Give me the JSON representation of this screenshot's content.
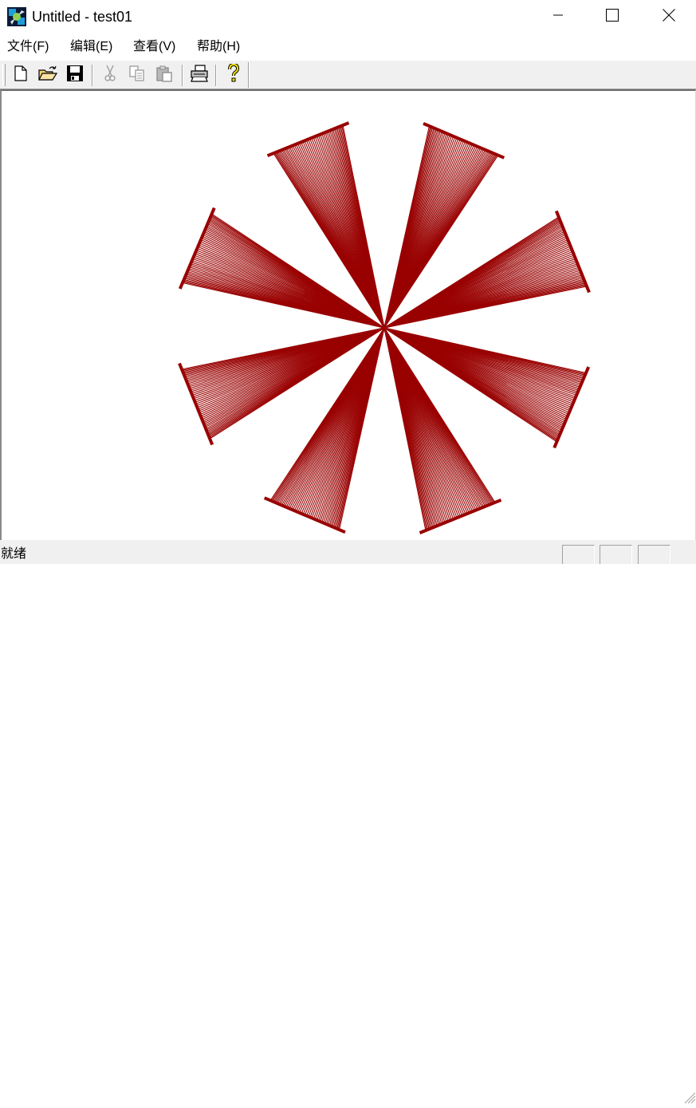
{
  "window": {
    "title": "Untitled - test01",
    "app_icon": "mfc-app-icon",
    "caption_buttons": [
      "minimize-icon",
      "maximize-icon",
      "close-icon"
    ]
  },
  "menubar": {
    "items": [
      {
        "label": "文件(F)"
      },
      {
        "label": "编辑(E)"
      },
      {
        "label": "查看(V)"
      },
      {
        "label": "帮助(H)"
      }
    ]
  },
  "toolbar": {
    "buttons": [
      {
        "icon": "new-file-icon",
        "enabled": true
      },
      {
        "icon": "open-folder-icon",
        "enabled": true
      },
      {
        "icon": "save-disk-icon",
        "enabled": true
      },
      {
        "icon": "cut-scissors-icon",
        "enabled": false
      },
      {
        "icon": "copy-icon",
        "enabled": false
      },
      {
        "icon": "paste-icon",
        "enabled": false
      },
      {
        "icon": "print-icon",
        "enabled": true
      },
      {
        "icon": "help-question-icon",
        "enabled": true
      }
    ]
  },
  "canvas": {
    "drawing": "rotated-rectangle-flower",
    "petal_count": 8,
    "line_color": "#990000"
  },
  "statusbar": {
    "text": "就绪",
    "panes": [
      "",
      "",
      ""
    ]
  },
  "colors": {
    "chrome": "#f0f0f0",
    "drawing": "#990000"
  }
}
